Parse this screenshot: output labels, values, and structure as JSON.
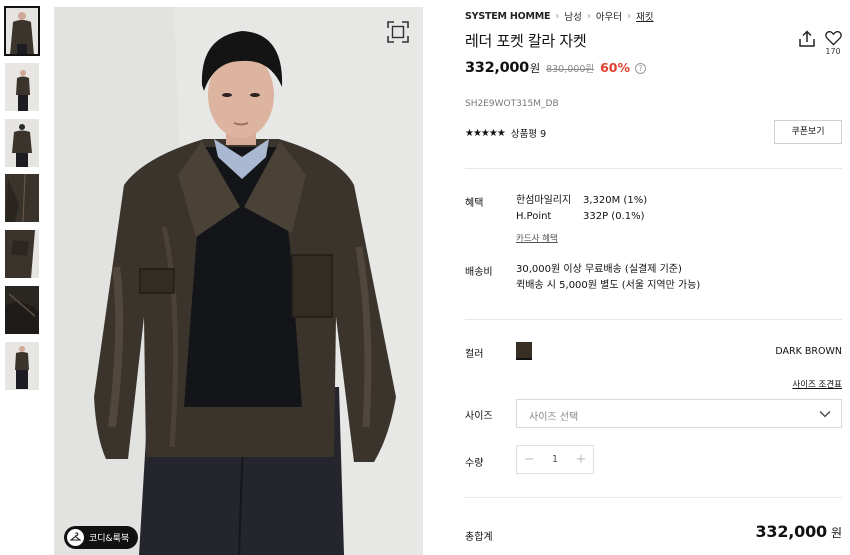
{
  "breadcrumb": {
    "brand": "SYSTEM HOMME",
    "items": [
      "남성",
      "아우터",
      "재킷"
    ]
  },
  "product": {
    "title": "레더 포켓 칼라 자켓",
    "price": "332,000",
    "price_unit": "원",
    "original_price": "830,000원",
    "discount": "60%",
    "sku": "SH2E9WOT315M_DB",
    "rating_stars": "★★★★★",
    "review_label": "상품평 9",
    "like_count": "170"
  },
  "buttons": {
    "coupon": "쿠폰보기",
    "lookbook": "코디&룩북"
  },
  "benefit": {
    "label": "혜택",
    "rows": [
      {
        "name": "한섬마일리지",
        "value": "3,320M (1%)"
      },
      {
        "name": "H.Point",
        "value": "332P (0.1%)"
      }
    ],
    "card_link": "카드사 혜택"
  },
  "shipping": {
    "label": "배송비",
    "lines": [
      "30,000원 이상 무료배송 (실결제 기준)",
      "퀵배송 시 5,000원 별도 (서울 지역만 가능)"
    ]
  },
  "color": {
    "label": "컬러",
    "name": "DARK BROWN",
    "swatch": "#3a2f24"
  },
  "size": {
    "label": "사이즈",
    "guide_link": "사이즈 조견표",
    "placeholder": "사이즈 선택"
  },
  "quantity": {
    "label": "수량",
    "value": "1"
  },
  "total": {
    "label": "총합계",
    "amount": "332,000",
    "unit": "원"
  },
  "colors": {
    "discount": "#e0402f",
    "jacket": "#3b342c"
  }
}
